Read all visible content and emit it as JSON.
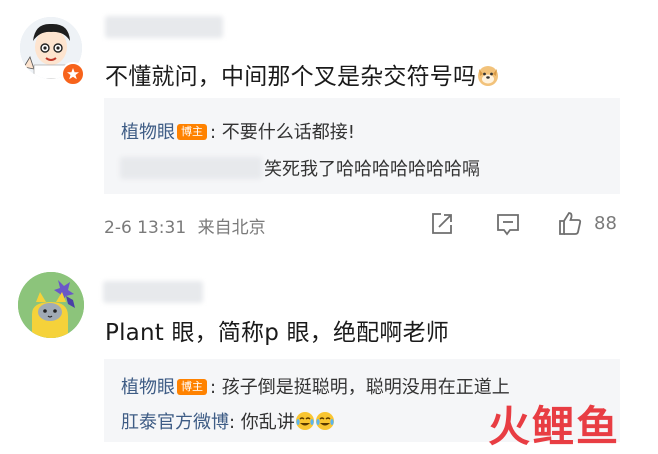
{
  "comments": [
    {
      "avatar_icon": "cartoon-boy-avatar",
      "verified_badge_icon": "orange-star-badge",
      "text": "不懂就问，中间那个叉是杂交符号吗",
      "emoji_icon": "doge-emoji",
      "replies": [
        {
          "author": "植物眼",
          "badge": "博主",
          "text": ": 不要什么话都接!"
        },
        {
          "text": "笑死我了哈哈哈哈哈哈哈嗝"
        }
      ],
      "time": "2-6 13:31",
      "source": "来自北京",
      "likes": "88"
    },
    {
      "avatar_icon": "yellow-cat-avatar",
      "text": "Plant 眼，简称p 眼，绝配啊老师",
      "replies": [
        {
          "author": "植物眼",
          "badge": "博主",
          "text": ": 孩子倒是挺聪明，聪明没用在正道上"
        },
        {
          "author": "肛泰官方微博",
          "text": ": 你乱讲",
          "emoji_icon": "crying-laughing-emoji"
        }
      ]
    }
  ],
  "watermark": "火鲤鱼",
  "colors": {
    "accent": "#ff8200",
    "link": "#3e5c85",
    "watermark": "#e8343a"
  }
}
